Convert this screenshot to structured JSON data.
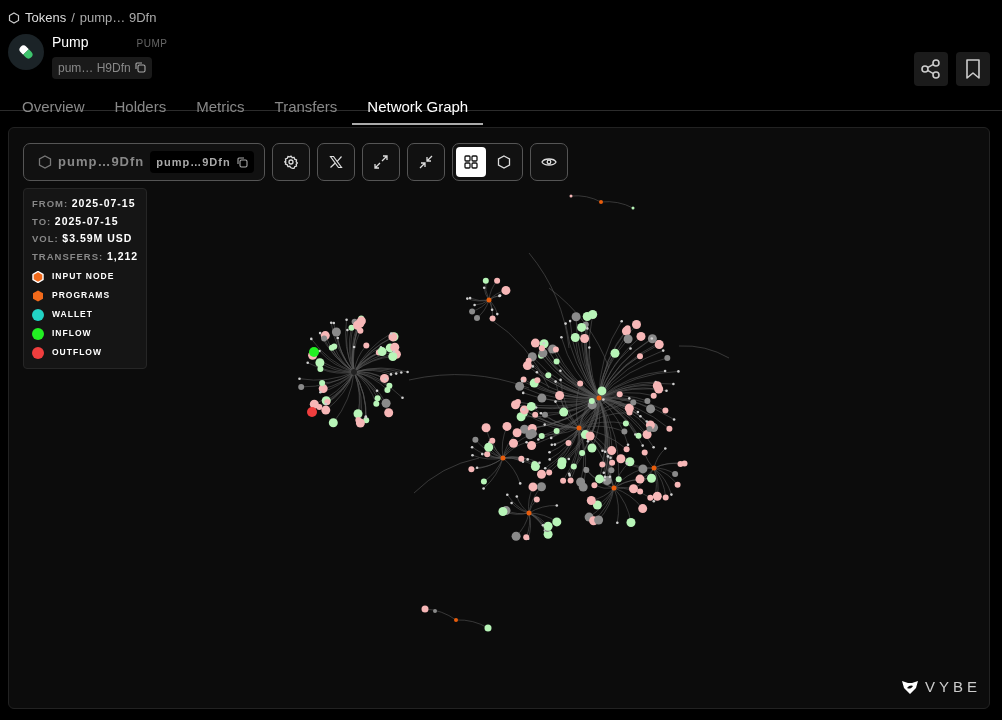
{
  "breadcrumb": {
    "root": "Tokens",
    "separator": "/",
    "current": "pump… 9Dfn"
  },
  "token": {
    "name": "Pump",
    "symbol": "PUMP",
    "address": "pum… H9Dfn"
  },
  "tabs": [
    {
      "label": "Overview",
      "selected": false
    },
    {
      "label": "Holders",
      "selected": false
    },
    {
      "label": "Metrics",
      "selected": false
    },
    {
      "label": "Transfers",
      "selected": false
    },
    {
      "label": "Network Graph",
      "selected": true
    }
  ],
  "toolbar": {
    "token_label": "pump…9Dfn",
    "address_chip": "pump…9Dfn",
    "view_toggle": [
      {
        "kind": "grid",
        "selected": true
      },
      {
        "kind": "hexagon",
        "selected": false
      }
    ]
  },
  "stats": [
    {
      "label": "FROM:",
      "value": "2025-07-15"
    },
    {
      "label": "TO:",
      "value": "2025-07-15"
    },
    {
      "label": "VOL:",
      "value": "$3.59M USD"
    },
    {
      "label": "TRANSFERS:",
      "value": "1,212"
    }
  ],
  "legend": [
    {
      "label": "INPUT NODE",
      "kind": "hexagon-outlined",
      "color": "#f26a1b"
    },
    {
      "label": "PROGRAMS",
      "kind": "hexagon",
      "color": "#f26a1b"
    },
    {
      "label": "WALLET",
      "kind": "circle",
      "color": "#22d3c5"
    },
    {
      "label": "INFLOW",
      "kind": "circle",
      "color": "#22f022"
    },
    {
      "label": "OUTFLOW",
      "kind": "circle",
      "color": "#f03e3e"
    }
  ],
  "brand": "VYBE"
}
